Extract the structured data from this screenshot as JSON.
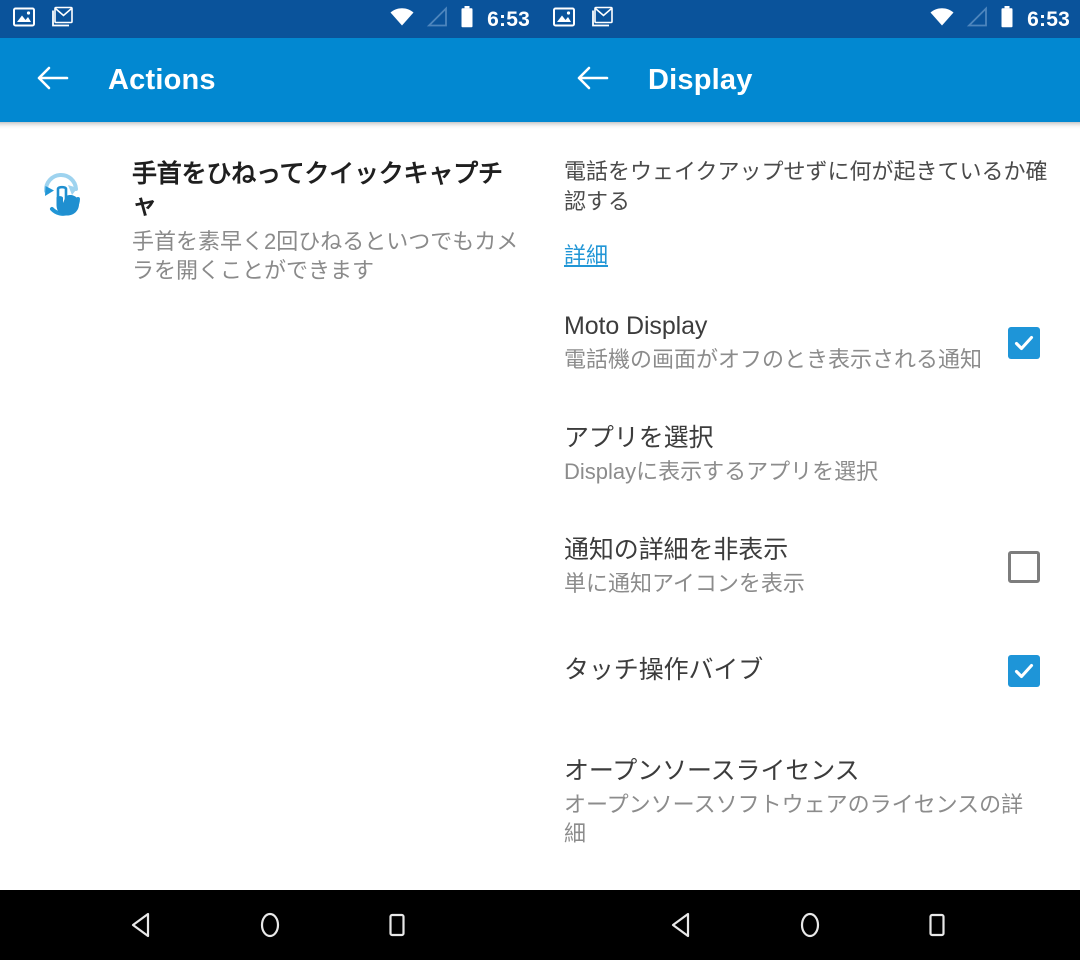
{
  "colors": {
    "status_bar": "#0A539B",
    "app_bar": "#0288D1",
    "accent": "#1e95d8",
    "link": "#2196d6",
    "nav_bar": "#000000",
    "title_text": "#3c3c3c",
    "subtitle_text": "#8c8c8c"
  },
  "status_bar": {
    "icons": [
      "photos-icon",
      "gmail-icon"
    ],
    "wifi_icon": "wifi-icon",
    "signal_icon": "signal-icon",
    "battery_icon": "battery-icon",
    "clock": "6:53"
  },
  "left_pane": {
    "app_bar": {
      "back_icon": "back-arrow-icon",
      "title": "Actions"
    },
    "action": {
      "icon": "wrist-twist-icon",
      "title": "手首をひねってクイックキャプチャ",
      "subtitle": "手首を素早く2回ひねるといつでもカメラを開くことができます"
    }
  },
  "right_pane": {
    "app_bar": {
      "back_icon": "back-arrow-icon",
      "title": "Display"
    },
    "intro": {
      "text": "電話をウェイクアップせずに何が起きているか確認する",
      "link": "詳細"
    },
    "preferences": [
      {
        "title": "Moto Display",
        "subtitle": "電話機の画面がオフのとき表示される通知",
        "control": "checkbox",
        "checked": true
      },
      {
        "title": "アプリを選択",
        "subtitle": "Displayに表示するアプリを選択",
        "control": "none",
        "checked": false
      },
      {
        "title": "通知の詳細を非表示",
        "subtitle": "単に通知アイコンを表示",
        "control": "checkbox",
        "checked": false
      },
      {
        "title": "タッチ操作バイブ",
        "subtitle": "",
        "control": "checkbox",
        "checked": true
      },
      {
        "title": "オープンソースライセンス",
        "subtitle": "オープンソースソフトウェアのライセンスの詳細",
        "control": "none",
        "checked": false
      }
    ]
  },
  "nav_bar": {
    "buttons": [
      "back-nav-icon",
      "home-nav-icon",
      "recents-nav-icon"
    ]
  }
}
